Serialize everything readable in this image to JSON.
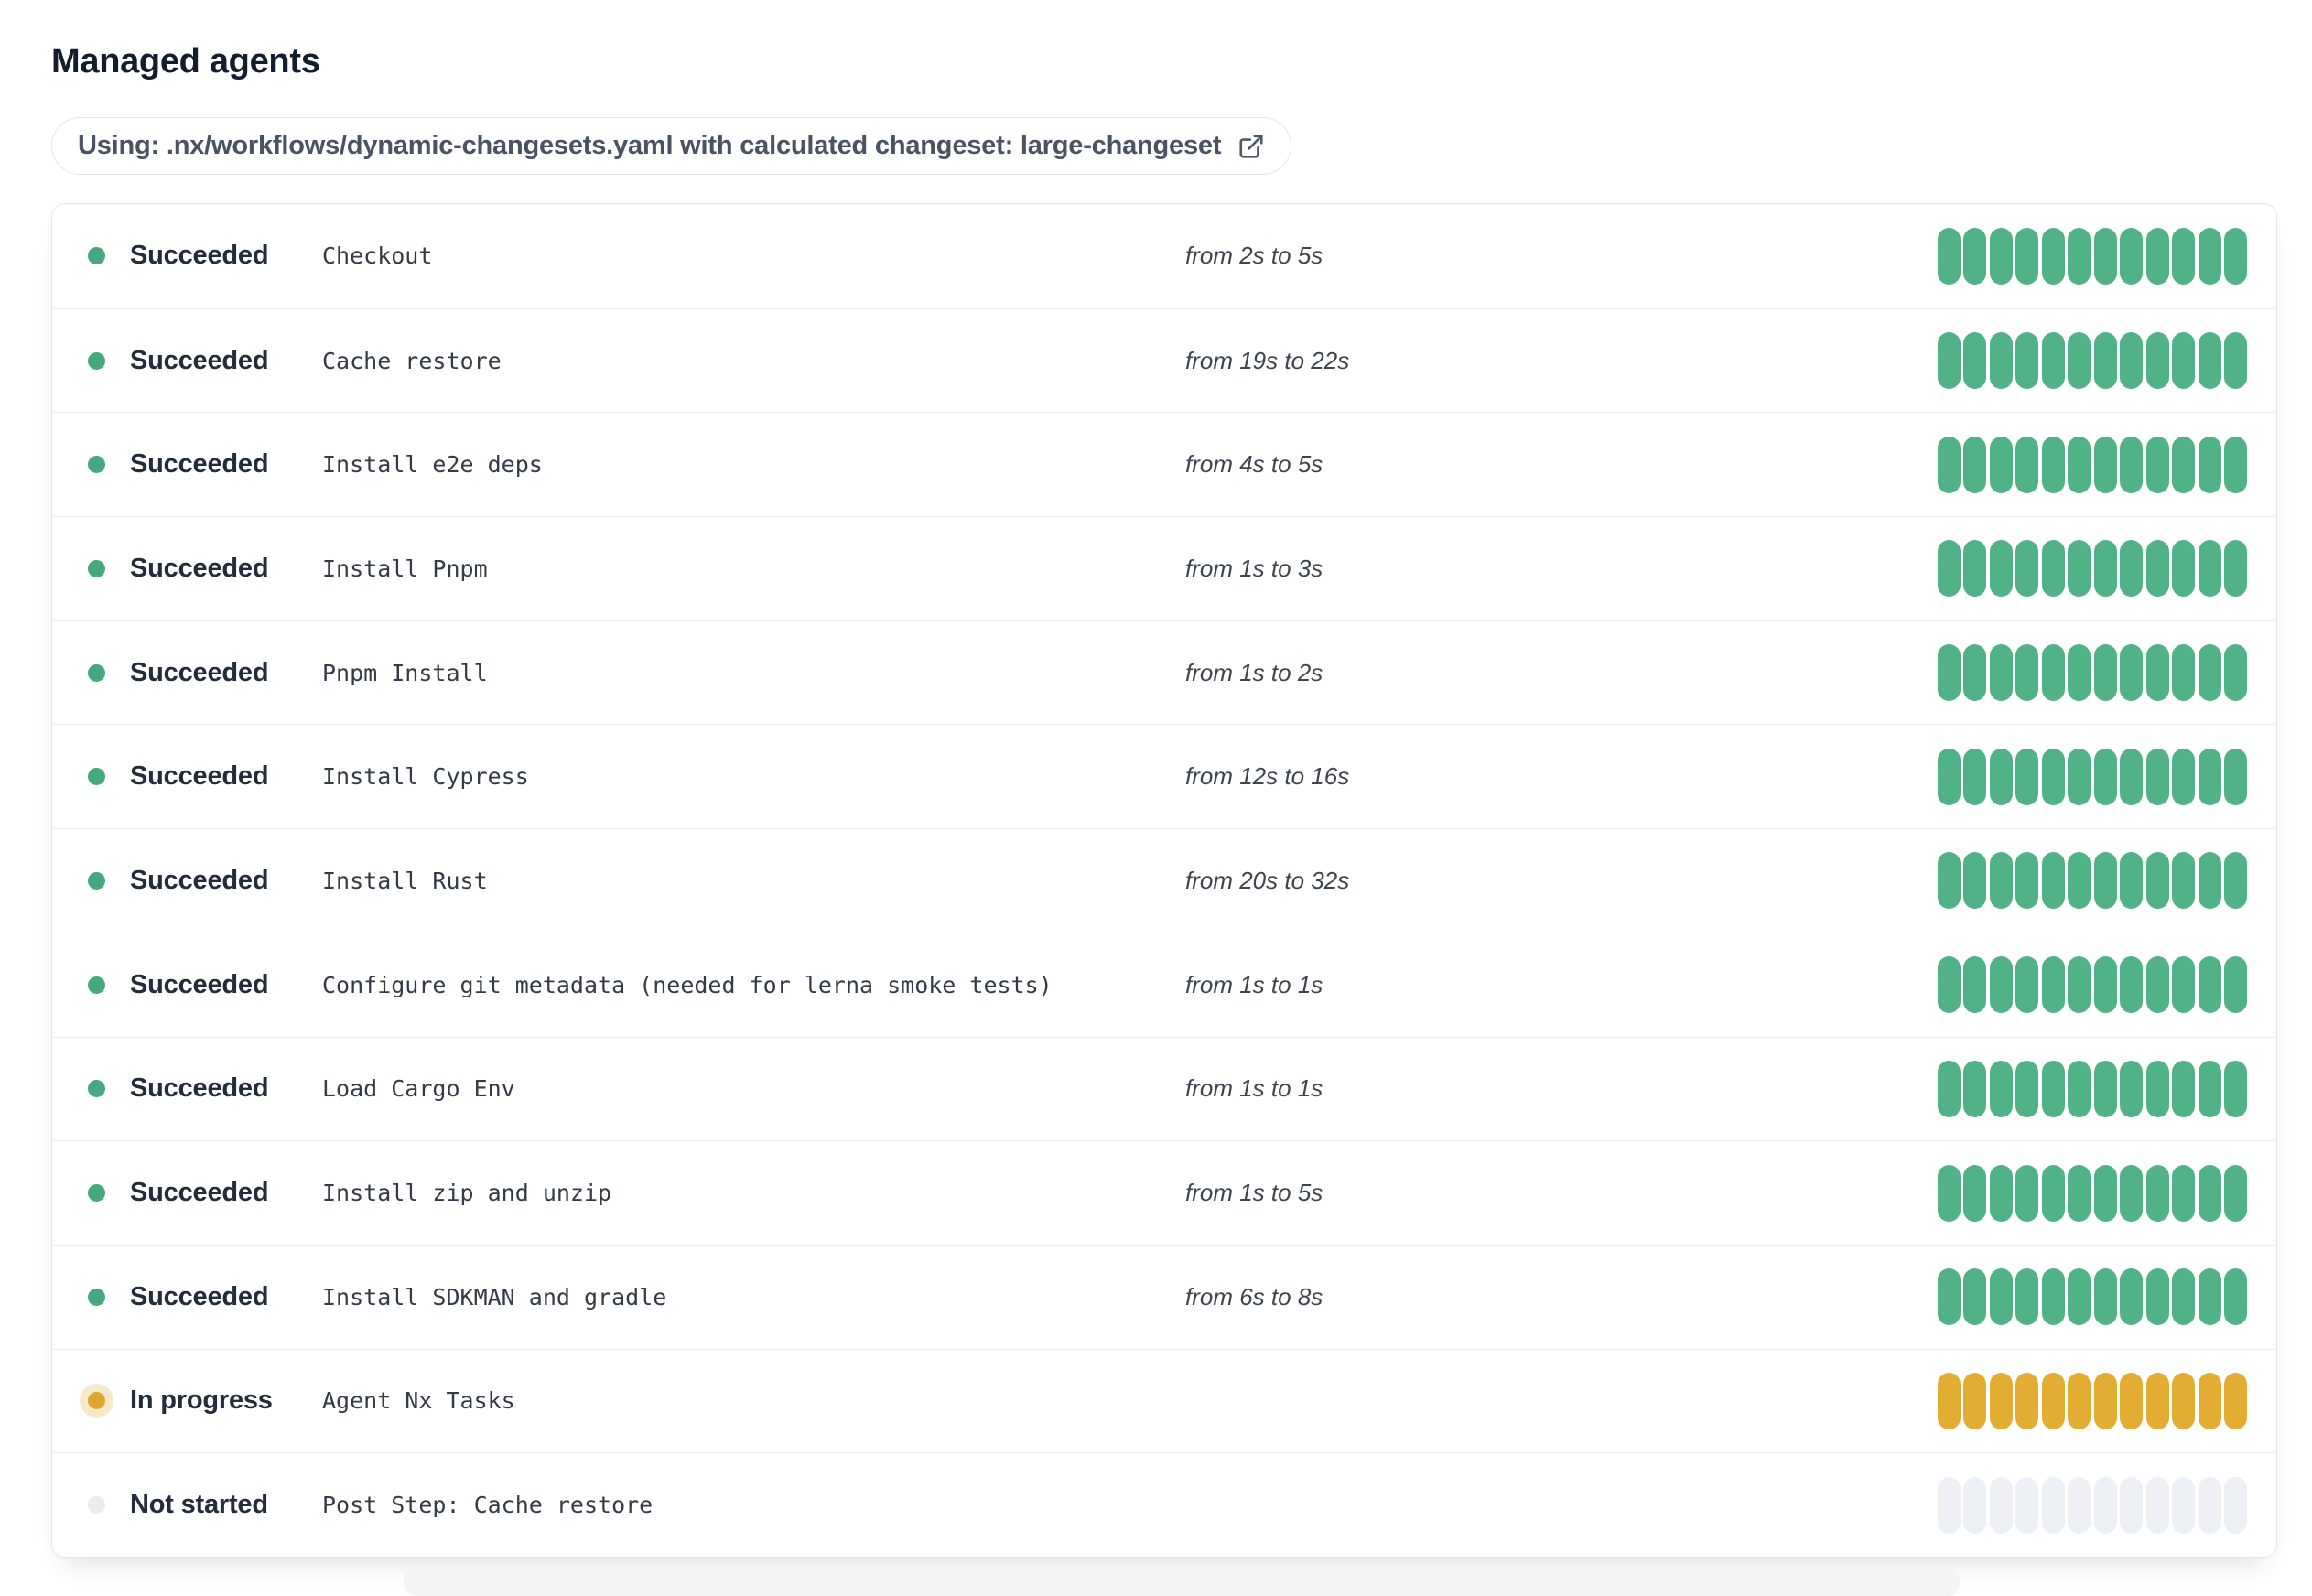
{
  "page": {
    "title": "Managed agents"
  },
  "workflow_badge": {
    "label": "Using: .nx/workflows/dynamic-changesets.yaml with calculated changeset: large-changeset",
    "icon": "external-link-icon"
  },
  "colors": {
    "succeeded_segment": "#52B287",
    "succeeded_dot": "#46A87C",
    "in_progress_segment": "#E3AC33",
    "in_progress_dot": "#DFA72F",
    "in_progress_halo": "#F5E9CB",
    "not_started_segment": "#EDF1F5",
    "not_started_dot": "#E8EDF2",
    "title_text": "#131D2C",
    "status_text": "#222C3B",
    "card_border": "#E4E6E9",
    "row_border": "#ECEEF1"
  },
  "agents": {
    "segments_per_bar": 12,
    "rows": [
      {
        "status": "Succeeded",
        "status_key": "succeeded",
        "name": "Checkout",
        "duration": "from 2s to 5s"
      },
      {
        "status": "Succeeded",
        "status_key": "succeeded",
        "name": "Cache restore",
        "duration": "from 19s to 22s"
      },
      {
        "status": "Succeeded",
        "status_key": "succeeded",
        "name": "Install e2e deps",
        "duration": "from 4s to 5s"
      },
      {
        "status": "Succeeded",
        "status_key": "succeeded",
        "name": "Install Pnpm",
        "duration": "from 1s to 3s"
      },
      {
        "status": "Succeeded",
        "status_key": "succeeded",
        "name": "Pnpm Install",
        "duration": "from 1s to 2s"
      },
      {
        "status": "Succeeded",
        "status_key": "succeeded",
        "name": "Install Cypress",
        "duration": "from 12s to 16s"
      },
      {
        "status": "Succeeded",
        "status_key": "succeeded",
        "name": "Install Rust",
        "duration": "from 20s to 32s"
      },
      {
        "status": "Succeeded",
        "status_key": "succeeded",
        "name": "Configure git metadata (needed for lerna smoke tests)",
        "duration": "from 1s to 1s"
      },
      {
        "status": "Succeeded",
        "status_key": "succeeded",
        "name": "Load Cargo Env",
        "duration": "from 1s to 1s"
      },
      {
        "status": "Succeeded",
        "status_key": "succeeded",
        "name": "Install zip and unzip",
        "duration": "from 1s to 5s"
      },
      {
        "status": "Succeeded",
        "status_key": "succeeded",
        "name": "Install SDKMAN and gradle",
        "duration": "from 6s to 8s"
      },
      {
        "status": "In progress",
        "status_key": "in-progress",
        "name": "Agent Nx Tasks",
        "duration": ""
      },
      {
        "status": "Not started",
        "status_key": "not-started",
        "name": "Post Step: Cache restore",
        "duration": ""
      }
    ]
  }
}
